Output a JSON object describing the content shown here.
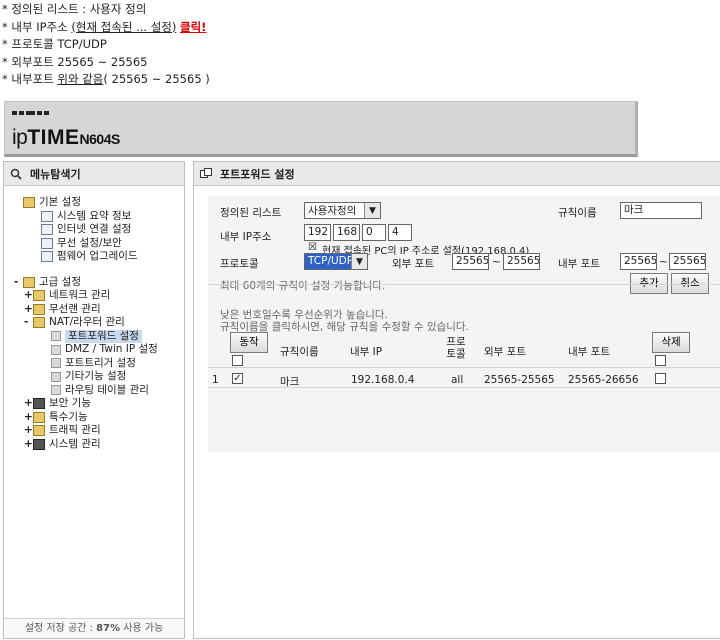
{
  "notes": {
    "line1": "* 정의된 리스트 :  사용자 정의",
    "line2_a": "* 내부 IP주소 ",
    "line2_b": "(현재 접속된 ... 설정)",
    "line2_c": "클릭!",
    "line3": "* 프로토콜 TCP/UDP",
    "line4": "* 외부포트 25565 ~ 25565",
    "line5_a": "* 내부포트 ",
    "line5_b": "위와 같음",
    "line5_c": "( 25565 ~ 25565 )"
  },
  "banner": {
    "brand_a": "ip",
    "brand_b": "TIME",
    "model": "N604S"
  },
  "sidebar": {
    "title": "메뉴탐색기",
    "items": [
      {
        "expander": "",
        "label": "기본 설정"
      },
      {
        "expander": "",
        "label": "시스템 요약 정보"
      },
      {
        "expander": "",
        "label": "인터넷 연결 설정"
      },
      {
        "expander": "",
        "label": "무선 설정/보안"
      },
      {
        "expander": "",
        "label": "펌웨어 업그레이드"
      },
      {
        "expander": "-",
        "label": "고급 설정"
      },
      {
        "expander": "+",
        "label": "네트워크 관리"
      },
      {
        "expander": "+",
        "label": "무선랜 관리"
      },
      {
        "expander": "-",
        "label": "NAT/라우터 관리"
      },
      {
        "expander": "",
        "label": "포트포워드 설정"
      },
      {
        "expander": "",
        "label": "DMZ / Twin IP 설정"
      },
      {
        "expander": "",
        "label": "포트트리거 설정"
      },
      {
        "expander": "",
        "label": "기타기능 설정"
      },
      {
        "expander": "",
        "label": "라우팅 테이블 관리"
      },
      {
        "expander": "+",
        "label": "보안 기능"
      },
      {
        "expander": "+",
        "label": "특수기능"
      },
      {
        "expander": "+",
        "label": "트래픽 관리"
      },
      {
        "expander": "+",
        "label": "시스템 관리"
      }
    ],
    "footer_a": "설정 저장 공간 : ",
    "footer_b": "87%",
    "footer_c": " 사용 가능"
  },
  "main": {
    "title": "포트포워드 설정",
    "form": {
      "list_label": "정의된 리스트",
      "list_value": "사용자정의",
      "rule_name_label": "규칙이름",
      "rule_name_value": "마크",
      "ip_label": "내부 IP주소",
      "ip": [
        "192",
        "168",
        "0",
        "4"
      ],
      "current_pc_checked": "☒",
      "current_pc_text": "현재 접속된 PC의 IP 주소로 설정(192.168.0.4)",
      "protocol_label": "프로토콜",
      "protocol_value": "TCP/UDP",
      "ext_port_label": "외부 포트",
      "ext_port_from": "25565",
      "ext_port_to": "25565",
      "int_port_label": "내부 포트",
      "int_port_from": "25565",
      "int_port_to": "25565",
      "tilde": "~",
      "max_rules_text": "최대 60개의 규칙이 설정 가능합니다.",
      "add_button": "추가",
      "cancel_button": "취소",
      "priority_note": "낮은 번호일수록 우선순위가 높습니다.",
      "edit_note": "규칙이름을 클릭하시면, 해당 규칙을 수정할 수 있습니다."
    },
    "table": {
      "action_button": "동작",
      "delete_button": "삭제",
      "headers": [
        "규칙이름",
        "내부 IP",
        "프로\n토콜",
        "외부 포트",
        "내부 포트"
      ],
      "rows": [
        {
          "num": "1",
          "checked": "✓",
          "name": "마크",
          "ip": "192.168.0.4",
          "protocol": "all",
          "ext": "25565-25565",
          "int": "25565-26656"
        }
      ]
    }
  }
}
